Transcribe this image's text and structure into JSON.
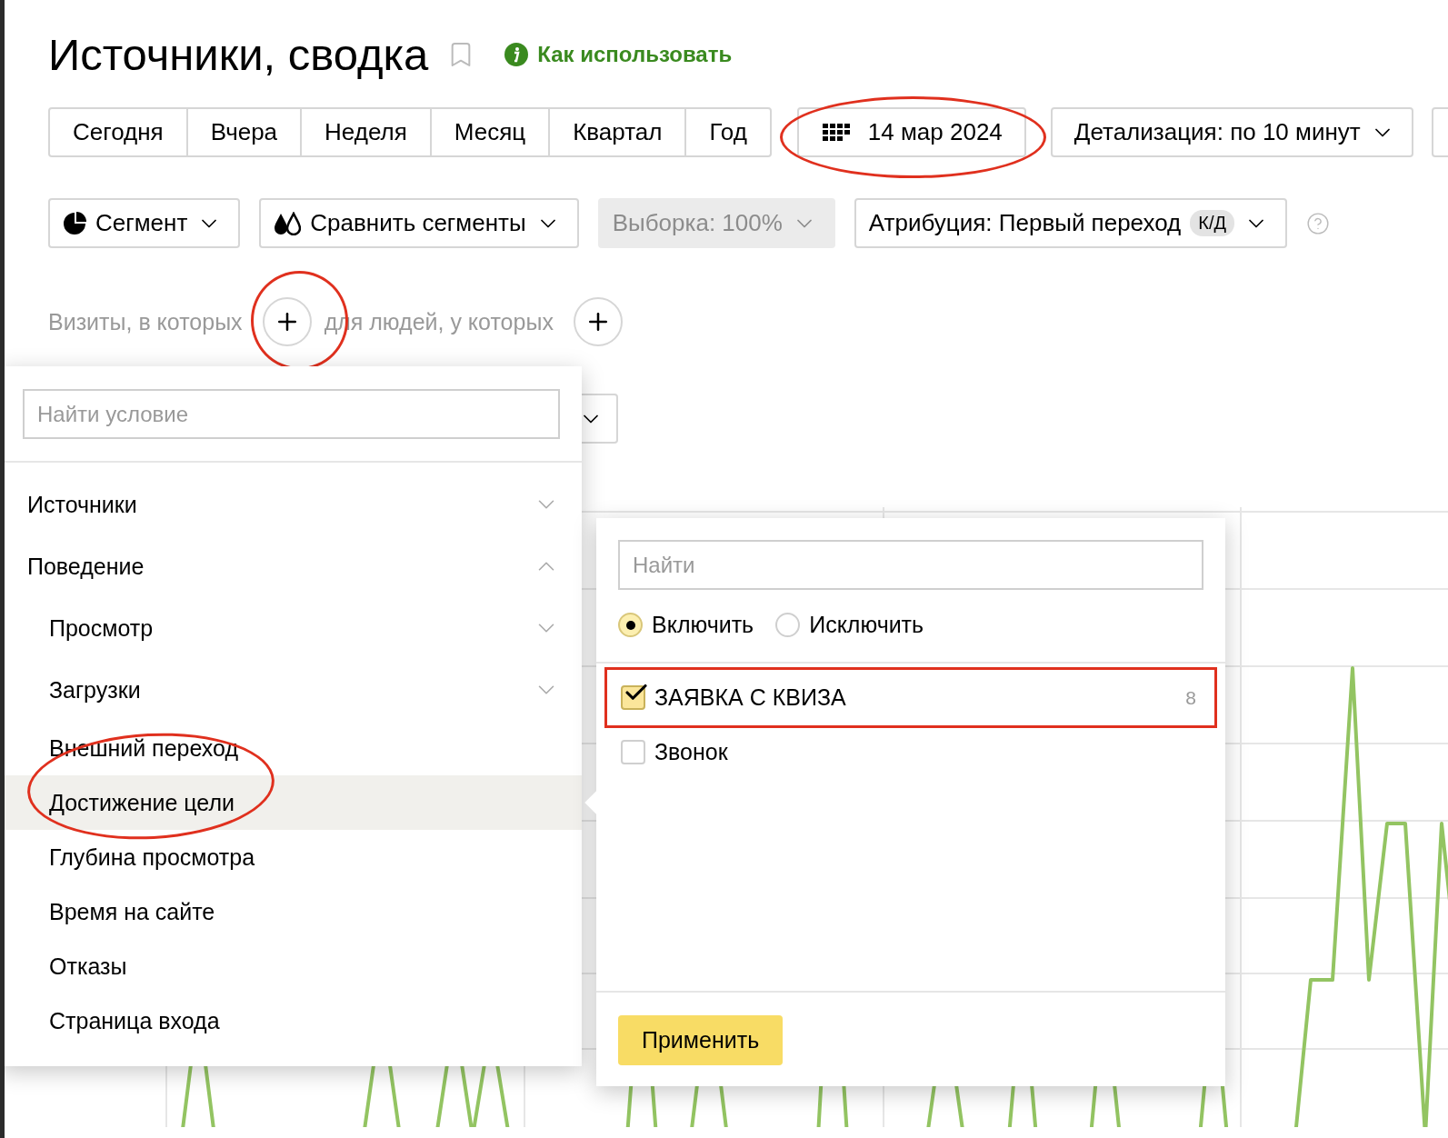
{
  "header": {
    "title": "Источники, сводка",
    "help_link": "Как использовать"
  },
  "periods": [
    {
      "label": "Сегодня",
      "selected": false
    },
    {
      "label": "Вчера",
      "selected": false
    },
    {
      "label": "Неделя",
      "selected": false
    },
    {
      "label": "Месяц",
      "selected": false
    },
    {
      "label": "Квартал",
      "selected": false
    },
    {
      "label": "Год",
      "selected": false
    }
  ],
  "date": {
    "label": "14 мар 2024",
    "circled": true
  },
  "detail": {
    "label": "Детализация: по 10 минут"
  },
  "filters": [
    {
      "kind": "segment",
      "label": "Сегмент",
      "disabled": false
    },
    {
      "kind": "compare",
      "label": "Сравнить сегменты",
      "disabled": false
    },
    {
      "kind": "sample",
      "label": "Выборка: 100%",
      "disabled": true
    },
    {
      "kind": "attribution",
      "label": "Атрибуция: Первый переход",
      "badge": "К/Д",
      "disabled": false
    }
  ],
  "conditions": {
    "visits": {
      "label": "Визиты, в которых",
      "circled": true
    },
    "people": {
      "label": "для людей, у которых"
    }
  },
  "condition_menu": {
    "search_placeholder": "Найти условие",
    "items": [
      {
        "label": "Источники",
        "kind": "group",
        "expanded": false,
        "selected": false
      },
      {
        "label": "Поведение",
        "kind": "group",
        "expanded": true,
        "selected": false,
        "children": [
          {
            "label": "Просмотр",
            "kind": "group",
            "expanded": false,
            "selected": false
          },
          {
            "label": "Загрузки",
            "kind": "group",
            "expanded": false,
            "selected": false
          },
          {
            "label": "Внешний переход",
            "kind": "item",
            "selected": false
          },
          {
            "label": "Достижение цели",
            "kind": "item",
            "selected": true,
            "circled": true
          },
          {
            "label": "Глубина просмотра",
            "kind": "item",
            "selected": false
          },
          {
            "label": "Время на сайте",
            "kind": "item",
            "selected": false
          },
          {
            "label": "Отказы",
            "kind": "item",
            "selected": false
          },
          {
            "label": "Страница входа",
            "kind": "item",
            "selected": false
          }
        ]
      }
    ]
  },
  "goal_panel": {
    "search_placeholder": "Найти",
    "modes": [
      {
        "label": "Включить",
        "selected": true
      },
      {
        "label": "Исключить",
        "selected": false
      }
    ],
    "goals": [
      {
        "label": "ЗАЯВКА С КВИЗА",
        "checked": true,
        "count": "8",
        "boxed": true
      },
      {
        "label": "Звонок",
        "checked": false,
        "boxed": false
      }
    ],
    "apply": "Применить"
  }
}
